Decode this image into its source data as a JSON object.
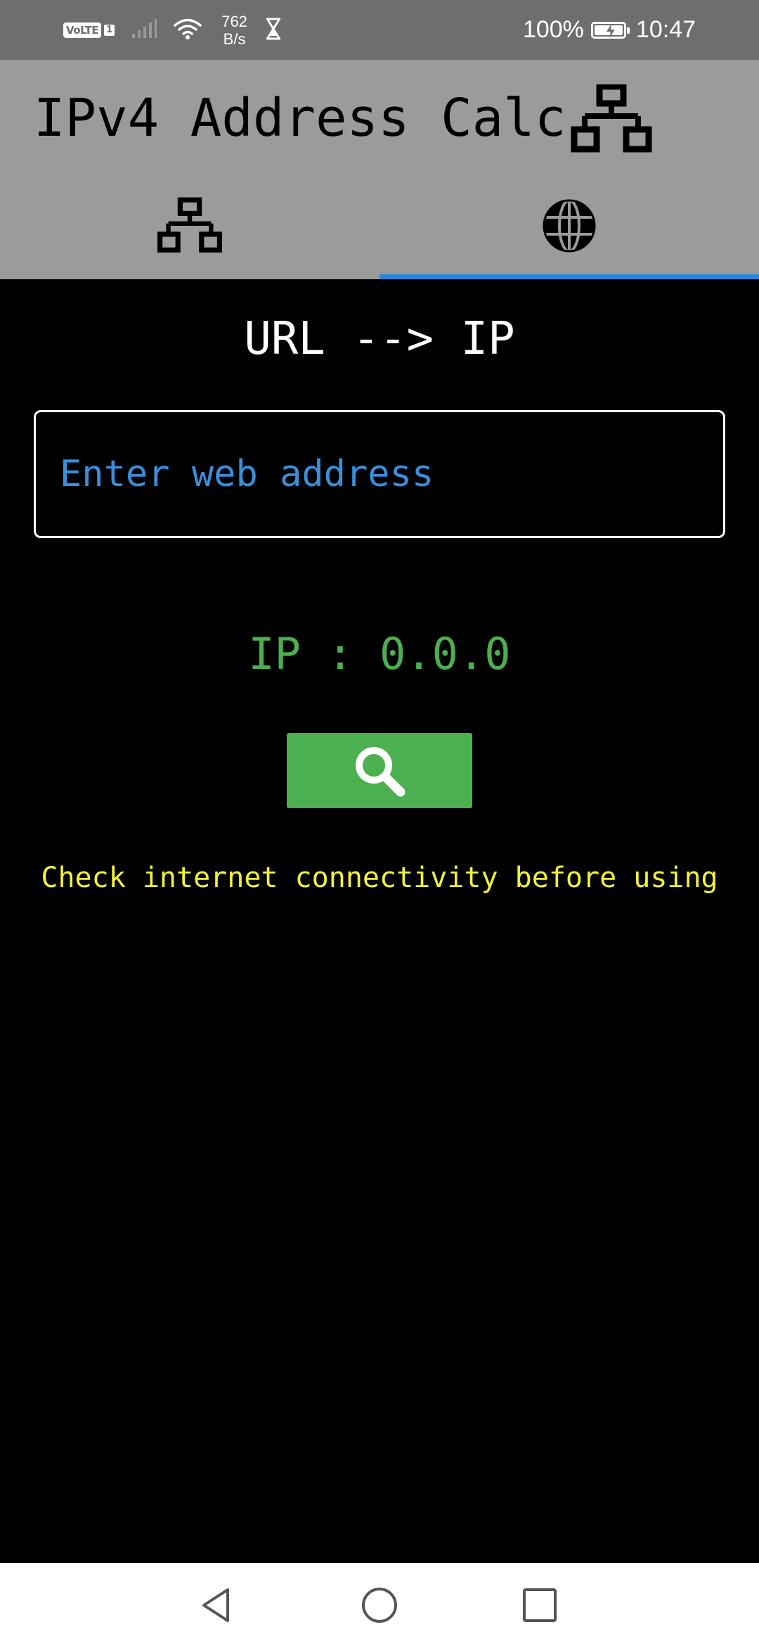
{
  "status_bar": {
    "network_badge": "VoLTE",
    "sim_badge": "1",
    "speed_value": "762",
    "speed_unit": "B/s",
    "battery_percent": "100%",
    "time": "10:47"
  },
  "header": {
    "title": "IPv4 Address Calc",
    "title_icon": "network-icon"
  },
  "tabs": [
    {
      "icon": "network-icon",
      "active": false
    },
    {
      "icon": "globe-icon",
      "active": true
    }
  ],
  "main": {
    "section_title": "URL --> IP",
    "url_input": {
      "value": "",
      "placeholder": "Enter web address"
    },
    "ip_result": "IP : 0.0.0",
    "search_button_icon": "search-icon",
    "warning": "Check internet connectivity before using"
  },
  "nav_bar": {
    "back_icon": "back-icon",
    "home_icon": "home-icon",
    "recents_icon": "recents-icon"
  },
  "colors": {
    "header_bg": "#9b9b9b",
    "status_bg": "#6e6e6e",
    "tab_indicator": "#2a86d8",
    "placeholder": "#3a8fdc",
    "ip_text": "#4caf50",
    "button_bg": "#4caf50",
    "warning_text": "#f2f23c"
  }
}
